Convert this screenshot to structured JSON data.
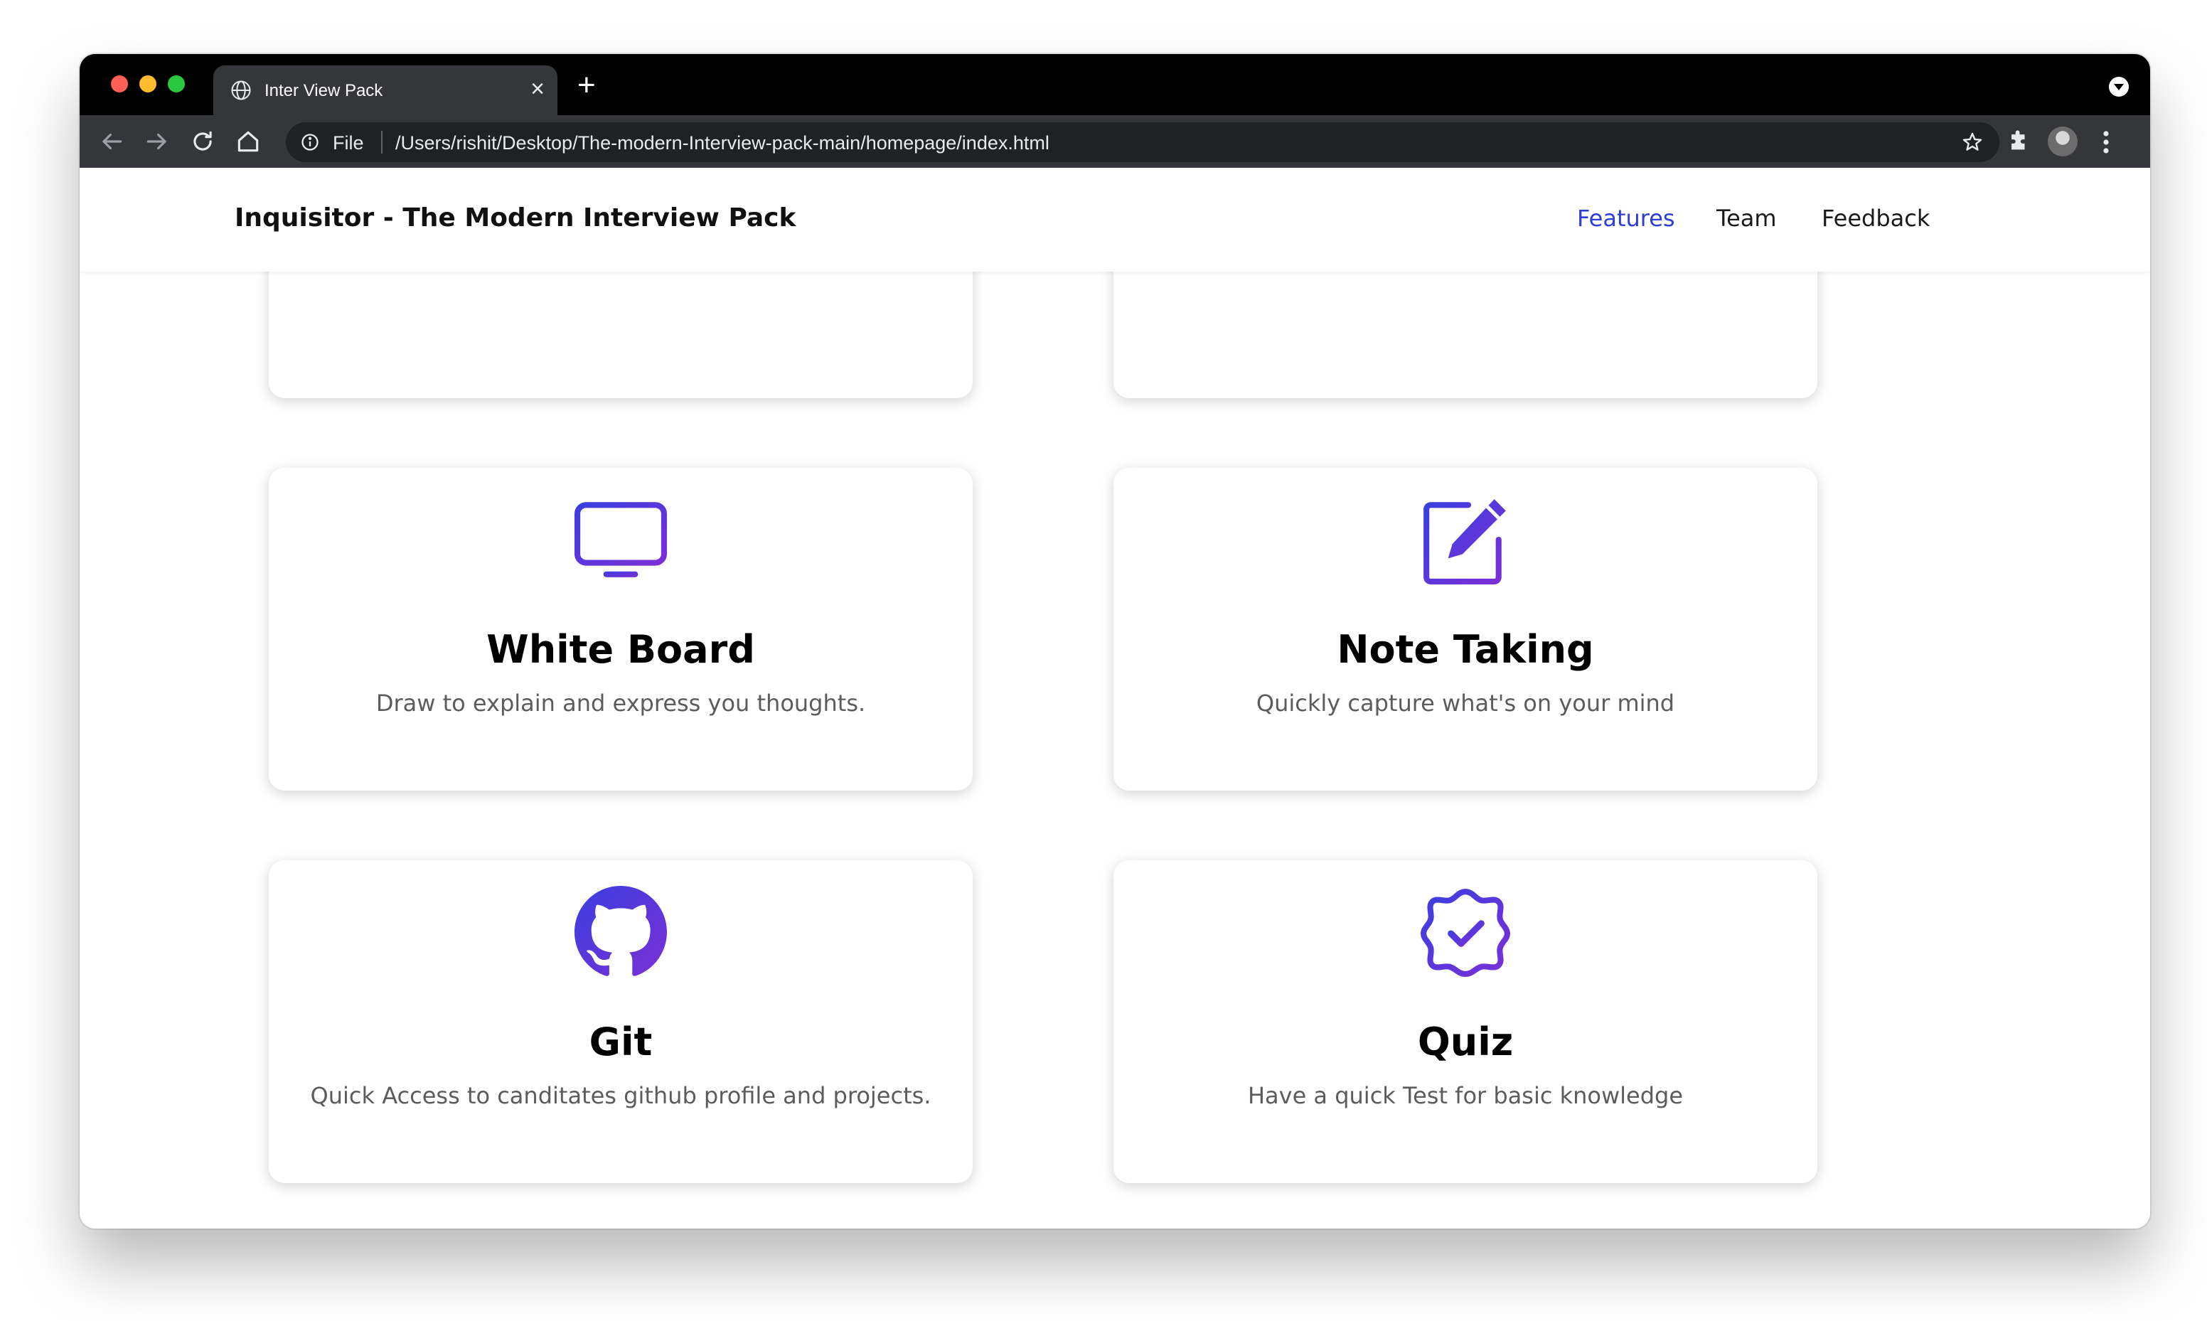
{
  "browser": {
    "tab_title": "Inter View Pack",
    "new_tab": "+",
    "tab_close": "×",
    "scheme": "File",
    "url": "/Users/rishit/Desktop/The-modern-Interview-pack-main/homepage/index.html"
  },
  "header": {
    "brand": "Inquisitor - The Modern Interview Pack",
    "nav": [
      {
        "label": "Features",
        "active": true
      },
      {
        "label": "Team",
        "active": false
      },
      {
        "label": "Feedback",
        "active": false
      }
    ]
  },
  "features": [
    {
      "icon": "monitor-icon",
      "title": "White Board",
      "description": "Draw to explain and express you thoughts."
    },
    {
      "icon": "edit-note-icon",
      "title": "Note Taking",
      "description": "Quickly capture what's on your mind"
    },
    {
      "icon": "github-icon",
      "title": "Git",
      "description": "Quick Access to canditates github profile and projects."
    },
    {
      "icon": "badge-check-icon",
      "title": "Quiz",
      "description": "Have a quick Test for basic knowledge"
    }
  ],
  "colors": {
    "accent": "#2b3fd4",
    "icon_gradient_start": "#3a3fe0",
    "icon_gradient_end": "#7b2fd6",
    "titlebar": "#000000",
    "toolbar": "#35363a"
  }
}
